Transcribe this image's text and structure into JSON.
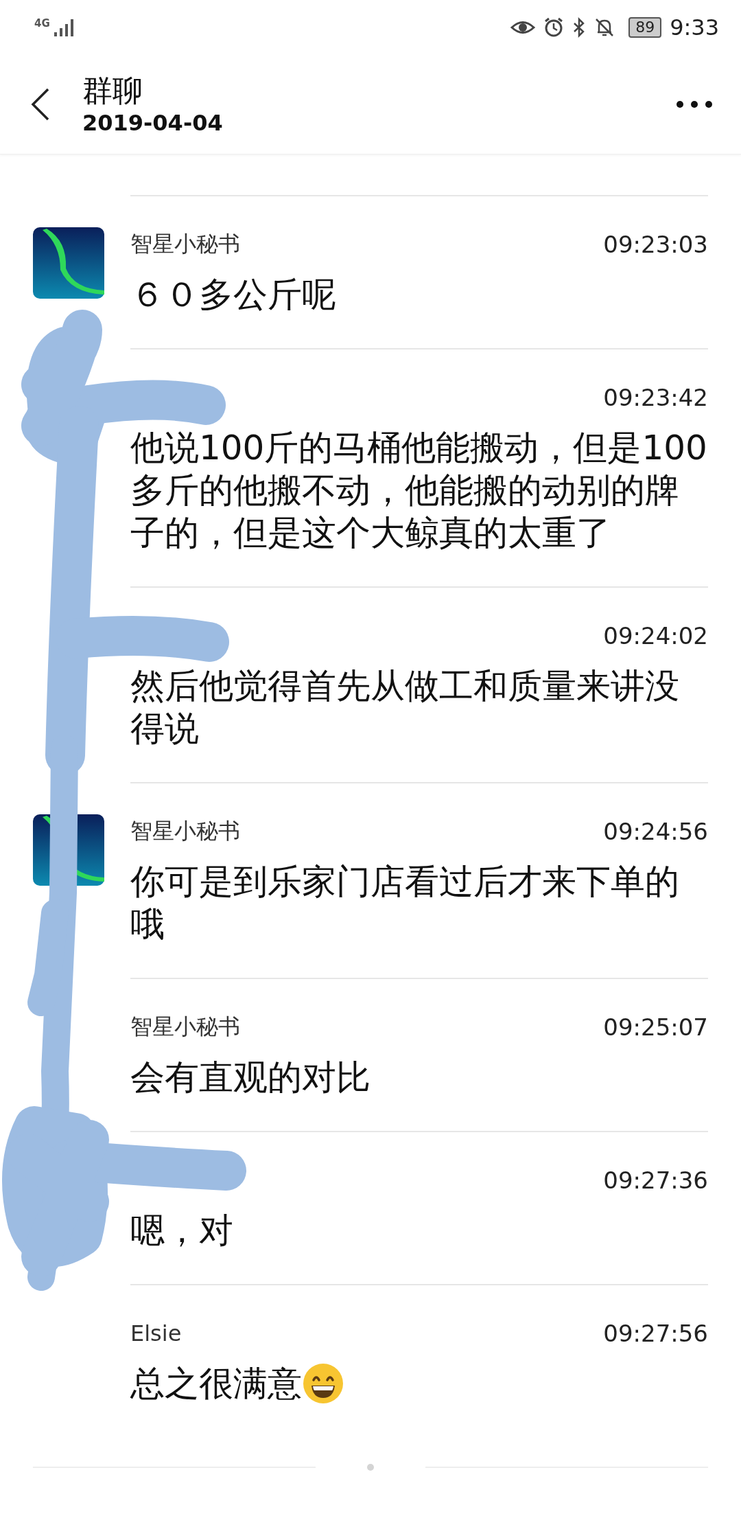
{
  "status_bar": {
    "network": "4G",
    "battery": "89",
    "time": "9:33"
  },
  "header": {
    "title": "群聊",
    "subtitle": "2019-04-04"
  },
  "messages": [
    {
      "avatar": {
        "kind": "aurora"
      },
      "sender": "智星小秘书",
      "time": "09:23:03",
      "text": "６０多公斤呢"
    },
    {
      "time": "09:23:42",
      "text": "他说100斤的马桶他能搬动，但是100多斤的他搬不动，他能搬的动别的牌子的，但是这个大鲸真的太重了"
    },
    {
      "time": "09:24:02",
      "text": "然后他觉得首先从做工和质量来讲没得说"
    },
    {
      "avatar": {
        "kind": "aurora"
      },
      "sender": "智星小秘书",
      "time": "09:24:56",
      "text": "你可是到乐家门店看过后才来下单的哦"
    },
    {
      "sender": "智星小秘书",
      "time": "09:25:07",
      "text": "会有直观的对比"
    },
    {
      "time": "09:27:36",
      "text": "嗯，对"
    },
    {
      "sender": "Elsie",
      "time": "09:27:56",
      "text": "总之很满意",
      "emoji": {
        "kind": "grin"
      }
    }
  ],
  "redaction": {
    "kind": "scribble"
  }
}
